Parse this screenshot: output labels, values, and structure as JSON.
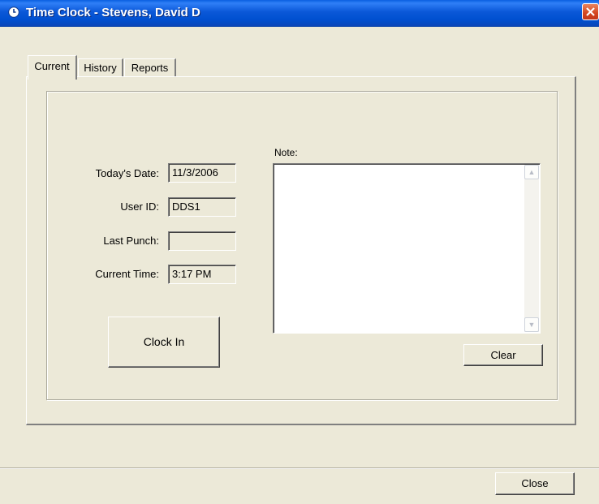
{
  "window": {
    "title": "Time Clock - Stevens, David D",
    "icon": "clock-icon",
    "close_icon": "close-icon"
  },
  "tabs": [
    {
      "label": "Current",
      "active": true
    },
    {
      "label": "History",
      "active": false
    },
    {
      "label": "Reports",
      "active": false
    }
  ],
  "current": {
    "todays_date_label": "Today's Date:",
    "todays_date_value": "11/3/2006",
    "user_id_label": "User ID:",
    "user_id_value": "DDS1",
    "last_punch_label": "Last Punch:",
    "last_punch_value": "",
    "current_time_label": "Current Time:",
    "current_time_value": "3:17 PM",
    "clock_in_label": "Clock In",
    "note_label": "Note:",
    "note_value": "",
    "clear_label": "Clear"
  },
  "footer": {
    "close_label": "Close"
  },
  "colors": {
    "titlebar": "#0054e3",
    "window_bg": "#ece9d8",
    "close_button": "#d4461f"
  }
}
